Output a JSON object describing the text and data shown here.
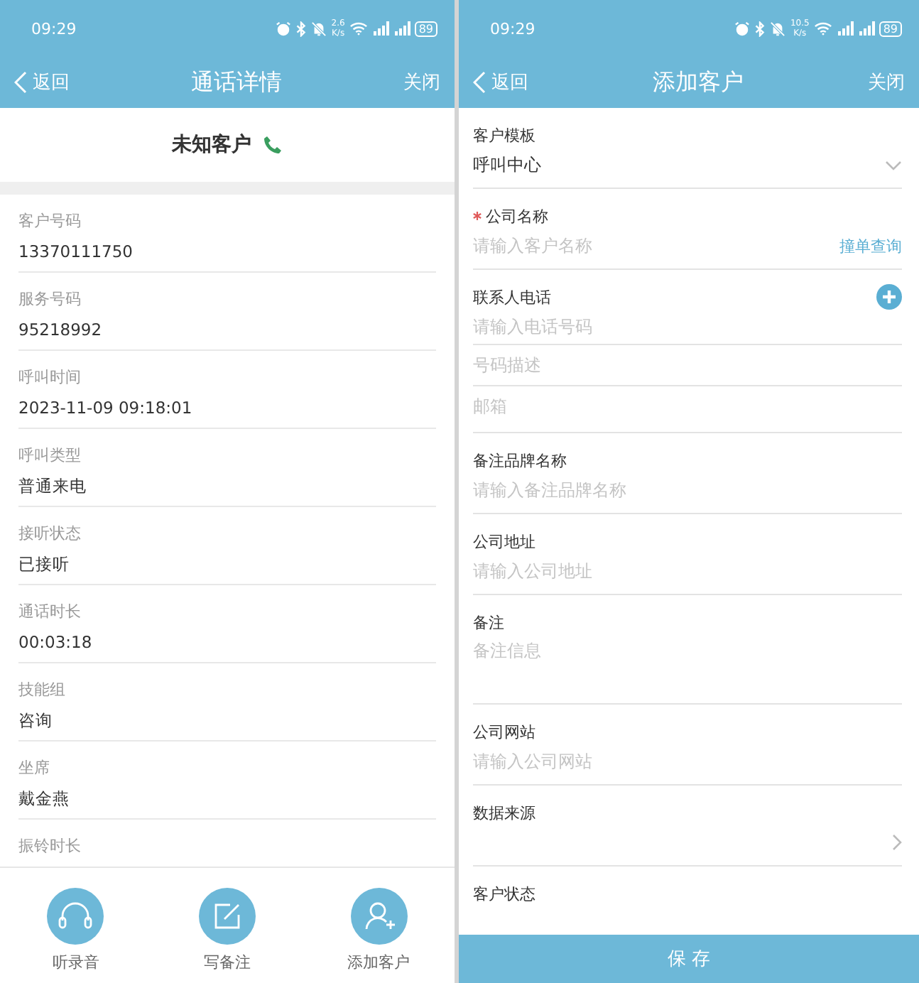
{
  "call_detail": {
    "status_bar": {
      "time": "09:29",
      "speed_value": "2.6",
      "speed_unit": "K/s",
      "battery": "89"
    },
    "nav": {
      "back": "返回",
      "title": "通话详情",
      "close": "关闭"
    },
    "caller": "未知客户",
    "fields": [
      {
        "label": "客户号码",
        "value": "13370111750"
      },
      {
        "label": "服务号码",
        "value": "95218992"
      },
      {
        "label": "呼叫时间",
        "value": "2023-11-09 09:18:01"
      },
      {
        "label": "呼叫类型",
        "value": "普通来电"
      },
      {
        "label": "接听状态",
        "value": "已接听"
      },
      {
        "label": "通话时长",
        "value": "00:03:18"
      },
      {
        "label": "技能组",
        "value": "咨询"
      },
      {
        "label": "坐席",
        "value": "戴金燕"
      },
      {
        "label": "振铃时长"
      }
    ],
    "actions": [
      {
        "kind": "headphones",
        "label": "听录音"
      },
      {
        "kind": "note",
        "label": "写备注"
      },
      {
        "kind": "add-user",
        "label": "添加客户"
      }
    ]
  },
  "add_customer": {
    "status_bar": {
      "time": "09:29",
      "speed_value": "10.5",
      "speed_unit": "K/s",
      "battery": "89"
    },
    "nav": {
      "back": "返回",
      "title": "添加客户",
      "close": "关闭"
    },
    "fields": [
      {
        "kind": "select",
        "label": "客户模板",
        "value": "呼叫中心"
      },
      {
        "kind": "text",
        "label": "公司名称",
        "required": true,
        "placeholder": "请输入客户名称",
        "action": "撞单查询"
      },
      {
        "kind": "phone",
        "label": "联系人电话",
        "inputs": [
          {
            "placeholder": "请输入电话号码"
          },
          {
            "placeholder": "号码描述"
          },
          {
            "placeholder": "邮箱"
          }
        ]
      },
      {
        "kind": "text",
        "label": "备注品牌名称",
        "placeholder": "请输入备注品牌名称"
      },
      {
        "kind": "text",
        "label": "公司地址",
        "placeholder": "请输入公司地址"
      },
      {
        "kind": "textarea",
        "label": "备注",
        "placeholder": "备注信息"
      },
      {
        "kind": "text",
        "label": "公司网站",
        "placeholder": "请输入公司网站"
      },
      {
        "kind": "picker",
        "label": "数据来源"
      },
      {
        "kind": "label",
        "label": "客户状态"
      }
    ],
    "save": "保 存"
  }
}
